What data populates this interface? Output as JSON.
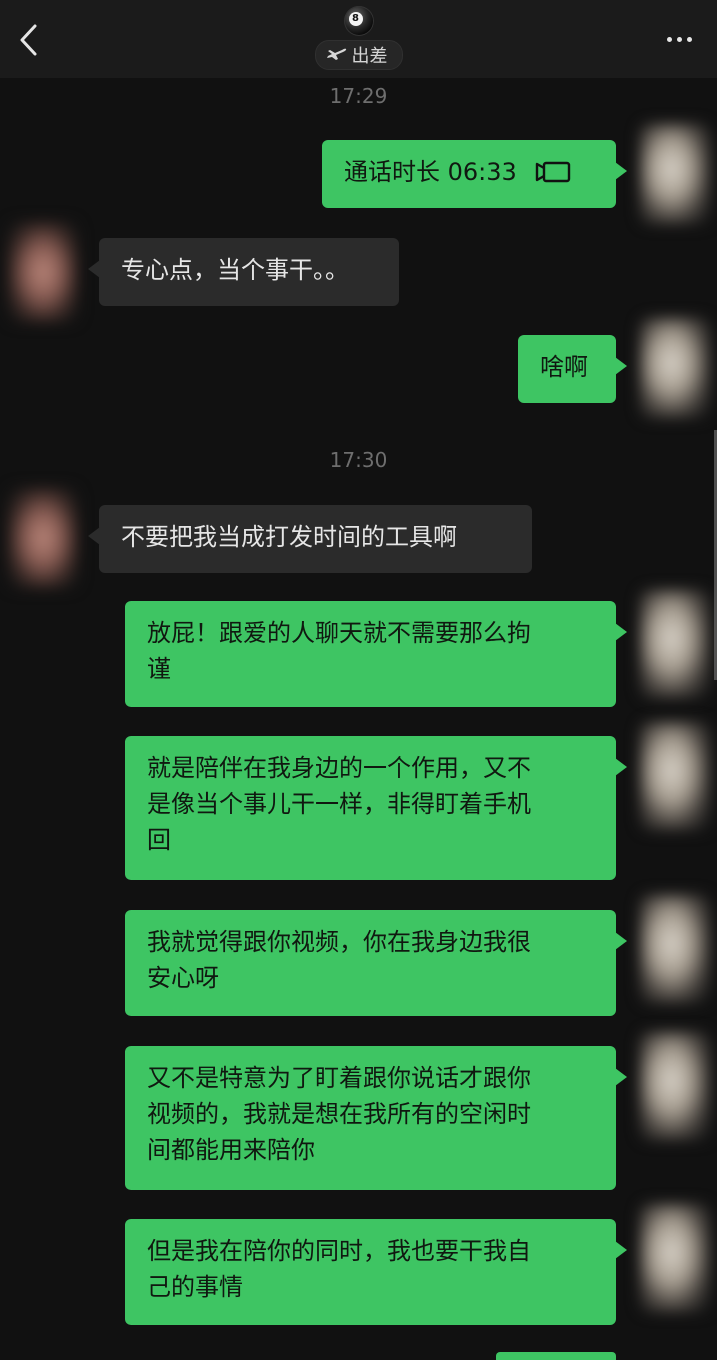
{
  "header": {
    "status_label": "出差",
    "contact_emoji": "8"
  },
  "timestamps": [
    "17:29",
    "17:30"
  ],
  "messages": [
    {
      "side": "out",
      "type": "call",
      "text": "通话时长 06:33",
      "icon": "video-call-icon"
    },
    {
      "side": "in",
      "text": "专心点，当个事干。。"
    },
    {
      "side": "out",
      "text": "啥啊"
    },
    {
      "side": "in",
      "text": "不要把我当成打发时间的工具啊"
    },
    {
      "side": "out",
      "text": "放屁！跟爱的人聊天就不需要那么拘\n谨"
    },
    {
      "side": "out",
      "text": "就是陪伴在我身边的一个作用，又不\n是像当个事儿干一样，非得盯着手机\n回"
    },
    {
      "side": "out",
      "text": "我就觉得跟你视频，你在我身边我很\n安心呀"
    },
    {
      "side": "out",
      "text": "又不是特意为了盯着跟你说话才跟你\n视频的，我就是想在我所有的空闲时\n间都能用来陪你"
    },
    {
      "side": "out",
      "text": "但是我在陪你的同时，我也要干我自\n己的事情"
    }
  ],
  "colors": {
    "background": "#111111",
    "header": "#1b1b1b",
    "outgoing_bubble": "#3ec563",
    "incoming_bubble": "#2b2b2b",
    "timestamp": "#6e6e6e"
  }
}
